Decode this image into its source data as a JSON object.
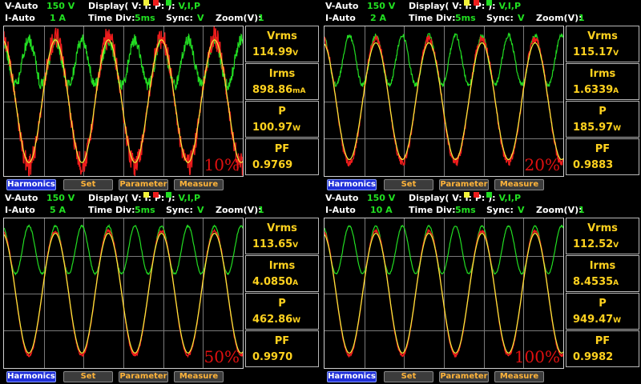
{
  "header_labels": {
    "v_range": "V-Auto",
    "i_range": "I-Auto",
    "display": "Display(",
    "display_v": "V:",
    "display_i": "I:",
    "display_p": "P:",
    "display_close": "):",
    "display_value": "V,I,P",
    "time_div": "Time  Div:",
    "sync": "Sync:",
    "zoom": "Zoom(V):"
  },
  "buttons": {
    "harmonics": "Harmonics",
    "set": "Set",
    "parameter": "Parameter",
    "measure": "Measure"
  },
  "colors": {
    "voltage_trace": "#f2f23a",
    "current_trace": "#ee1c1c",
    "power_trace": "#22dd22",
    "value_text": "#ffd21e",
    "range_text": "#21e021"
  },
  "panels": [
    {
      "v_range_value": "150  V",
      "i_range_value": "1  A",
      "time_div_value": "5ms",
      "sync_value": "V",
      "zoom_value": "1",
      "vrms_label": "Vrms",
      "vrms": "114.99",
      "vrms_unit": "V",
      "irms_label": "Irms",
      "irms": "898.86",
      "irms_unit": "mA",
      "p_label": "P",
      "p": "100.97",
      "p_unit": "W",
      "pf_label": "PF",
      "pf": "0.9769",
      "load_label": "10%",
      "waveform": {
        "current_amplitude": 0.85,
        "current_noise": 0.16,
        "voltage_amplitude": 0.82,
        "power_offset": 0.52,
        "power_amplitude": 0.3
      }
    },
    {
      "v_range_value": "150  V",
      "i_range_value": "2  A",
      "time_div_value": "5ms",
      "sync_value": "V",
      "zoom_value": "1",
      "vrms_label": "Vrms",
      "vrms": "115.17",
      "vrms_unit": "V",
      "irms_label": "Irms",
      "irms": "1.6339",
      "irms_unit": "A",
      "p_label": "P",
      "p": "185.97",
      "p_unit": "W",
      "pf_label": "PF",
      "pf": "0.9883",
      "load_label": "20%",
      "waveform": {
        "current_amplitude": 0.82,
        "current_noise": 0.06,
        "voltage_amplitude": 0.78,
        "power_offset": 0.55,
        "power_amplitude": 0.33
      }
    },
    {
      "v_range_value": "150  V",
      "i_range_value": "5  A",
      "time_div_value": "5ms",
      "sync_value": "V",
      "zoom_value": "1",
      "vrms_label": "Vrms",
      "vrms": "113.65",
      "vrms_unit": "V",
      "irms_label": "Irms",
      "irms": "4.0850",
      "irms_unit": "A",
      "p_label": "P",
      "p": "462.86",
      "p_unit": "W",
      "pf_label": "PF",
      "pf": "0.9970",
      "load_label": "50%",
      "waveform": {
        "current_amplitude": 0.83,
        "current_noise": 0.02,
        "voltage_amplitude": 0.8,
        "power_offset": 0.58,
        "power_amplitude": 0.32
      }
    },
    {
      "v_range_value": "150  V",
      "i_range_value": "10  A",
      "time_div_value": "5ms",
      "sync_value": "V",
      "zoom_value": "1",
      "vrms_label": "Vrms",
      "vrms": "112.52",
      "vrms_unit": "V",
      "irms_label": "Irms",
      "irms": "8.4535",
      "irms_unit": "A",
      "p_label": "P",
      "p": "949.47",
      "p_unit": "W",
      "pf_label": "PF",
      "pf": "0.9982",
      "load_label": "100%",
      "waveform": {
        "current_amplitude": 0.83,
        "current_noise": 0.015,
        "voltage_amplitude": 0.8,
        "power_offset": 0.58,
        "power_amplitude": 0.32
      }
    }
  ]
}
